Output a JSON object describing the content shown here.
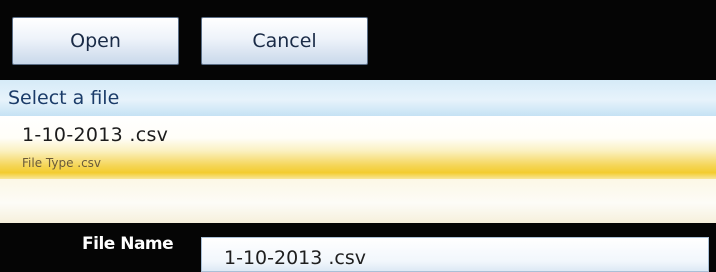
{
  "toolbar": {
    "open_label": "Open",
    "cancel_label": "Cancel"
  },
  "file_list": {
    "header": "Select a file",
    "items": [
      {
        "name": "1-10-2013 .csv",
        "type": "File Type .csv",
        "selected": true
      }
    ]
  },
  "file_name_field": {
    "label": "File Name",
    "value": "1-10-2013 .csv"
  },
  "colors": {
    "button_text": "#1a2b47",
    "header_text": "#1b3c69",
    "selection_highlight": "#f3cc2f",
    "background": "#050505"
  }
}
